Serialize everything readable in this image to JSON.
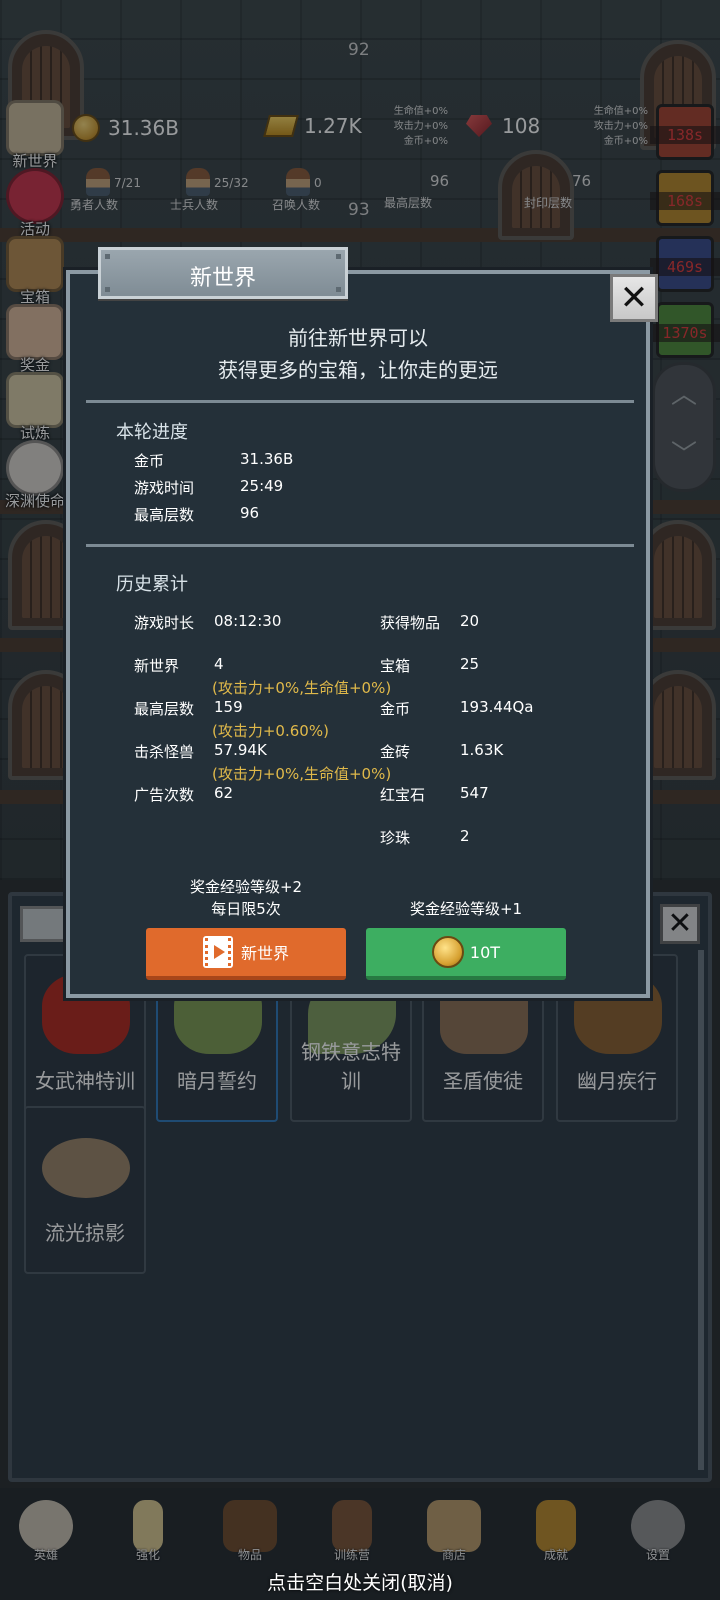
{
  "hud": {
    "floor_top": "92",
    "floor_mid": "93",
    "gold": "31.36B",
    "gold_bars": "1.27K",
    "rubies": "108",
    "bonus_left": [
      "生命值+0%",
      "攻击力+0%",
      "金币+0%"
    ],
    "bonus_right": [
      "生命值+0%",
      "攻击力+0%",
      "金币+0%"
    ],
    "heroes": {
      "value": "7/21",
      "label": "勇者人数"
    },
    "soldiers": {
      "value": "25/32",
      "label": "士兵人数"
    },
    "summons": {
      "value": "0",
      "label": "召唤人数"
    },
    "max_floor": {
      "value": "96",
      "label": "最高层数"
    },
    "sealed_floor": {
      "value": "76",
      "label": "封印层数"
    }
  },
  "side_menu": [
    {
      "label": "新世界"
    },
    {
      "label": "活动"
    },
    {
      "label": "宝箱"
    },
    {
      "label": "奖金"
    },
    {
      "label": "试炼"
    },
    {
      "label": "深渊使命"
    }
  ],
  "timers": [
    "138s",
    "168s",
    "469s",
    "1370s"
  ],
  "dialog": {
    "title": "新世界",
    "close": "✕",
    "intro_line1": "前往新世界可以",
    "intro_line2": "获得更多的宝箱，让你走的更远",
    "current": {
      "title": "本轮进度",
      "rows": [
        {
          "label": "金币",
          "value": "31.36B"
        },
        {
          "label": "游戏时间",
          "value": "25:49"
        },
        {
          "label": "最高层数",
          "value": "96"
        }
      ]
    },
    "history": {
      "title": "历史累计",
      "left": [
        {
          "label": "游戏时长",
          "value": "08:12:30"
        },
        {
          "label": "新世界",
          "value": "4",
          "bonus": "(攻击力+0%,生命值+0%)"
        },
        {
          "label": "最高层数",
          "value": "159",
          "bonus": "(攻击力+0.60%)"
        },
        {
          "label": "击杀怪兽",
          "value": "57.94K",
          "bonus": "(攻击力+0%,生命值+0%)"
        },
        {
          "label": "广告次数",
          "value": "62"
        }
      ],
      "right": [
        {
          "label": "获得物品",
          "value": "20"
        },
        {
          "label": "宝箱",
          "value": "25"
        },
        {
          "label": "金币",
          "value": "193.44Qa"
        },
        {
          "label": "金砖",
          "value": "1.63K"
        },
        {
          "label": "红宝石",
          "value": "547"
        },
        {
          "label": "珍珠",
          "value": "2"
        }
      ]
    },
    "btn_ad": {
      "caption1": "奖金经验等级+2",
      "caption2": "每日限5次",
      "label": "新世界"
    },
    "btn_coin": {
      "caption": "奖金经验等级+1",
      "label": "10T"
    }
  },
  "skills": [
    {
      "label": "女武神特训"
    },
    {
      "label": "暗月誓约"
    },
    {
      "label": "钢铁意志特训"
    },
    {
      "label": "圣盾使徒"
    },
    {
      "label": "幽月疾行"
    },
    {
      "label": "流光掠影"
    }
  ],
  "bottom_nav": [
    {
      "label": "英雄"
    },
    {
      "label": "强化"
    },
    {
      "label": "物品"
    },
    {
      "label": "训练营"
    },
    {
      "label": "商店"
    },
    {
      "label": "成就"
    },
    {
      "label": "设置"
    }
  ],
  "close_hint": "点击空白处关闭(取消)",
  "colors": {
    "accent_orange": "#e06a2c",
    "accent_green": "#3dae61",
    "bonus_gold": "#e0b94a",
    "timer_red": "#e23a3a"
  }
}
